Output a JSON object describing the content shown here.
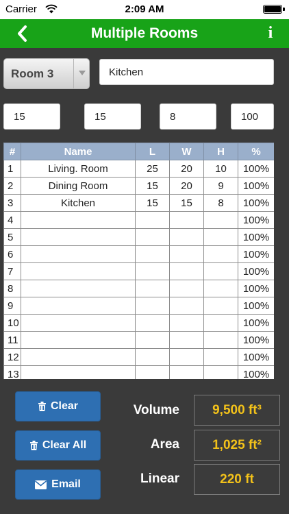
{
  "status_bar": {
    "carrier": "Carrier",
    "time": "2:09 AM"
  },
  "nav": {
    "title": "Multiple Rooms",
    "back_icon": "chevron-left-icon",
    "info_icon": "info-icon"
  },
  "room_selector": {
    "selected": "Room 3"
  },
  "room_name": "Kitchen",
  "dimensions": {
    "length": "15",
    "width": "15",
    "height": "8",
    "percent": "100"
  },
  "table": {
    "headers": [
      "#",
      "Name",
      "L",
      "W",
      "H",
      "%"
    ],
    "rows": [
      [
        "1",
        "Living. Room",
        "25",
        "20",
        "10",
        "100%"
      ],
      [
        "2",
        "Dining Room",
        "15",
        "20",
        "9",
        "100%"
      ],
      [
        "3",
        "Kitchen",
        "15",
        "15",
        "8",
        "100%"
      ],
      [
        "4",
        "",
        "",
        "",
        "",
        "100%"
      ],
      [
        "5",
        "",
        "",
        "",
        "",
        "100%"
      ],
      [
        "6",
        "",
        "",
        "",
        "",
        "100%"
      ],
      [
        "7",
        "",
        "",
        "",
        "",
        "100%"
      ],
      [
        "8",
        "",
        "",
        "",
        "",
        "100%"
      ],
      [
        "9",
        "",
        "",
        "",
        "",
        "100%"
      ],
      [
        "10",
        "",
        "",
        "",
        "",
        "100%"
      ],
      [
        "11",
        "",
        "",
        "",
        "",
        "100%"
      ],
      [
        "12",
        "",
        "",
        "",
        "",
        "100%"
      ],
      [
        "13",
        "",
        "",
        "",
        "",
        "100%"
      ]
    ]
  },
  "buttons": {
    "clear": "Clear",
    "clear_all": "Clear All",
    "email": "Email"
  },
  "results": {
    "volume_label": "Volume",
    "volume_value": "9,500 ft³",
    "area_label": "Area",
    "area_value": "1,025 ft²",
    "linear_label": "Linear",
    "linear_value": "220 ft"
  },
  "colors": {
    "nav_green": "#18a318",
    "button_blue": "#2e6fb2",
    "result_yellow": "#f3c21a",
    "table_header": "#9aafcb",
    "background": "#3a3a3a"
  }
}
